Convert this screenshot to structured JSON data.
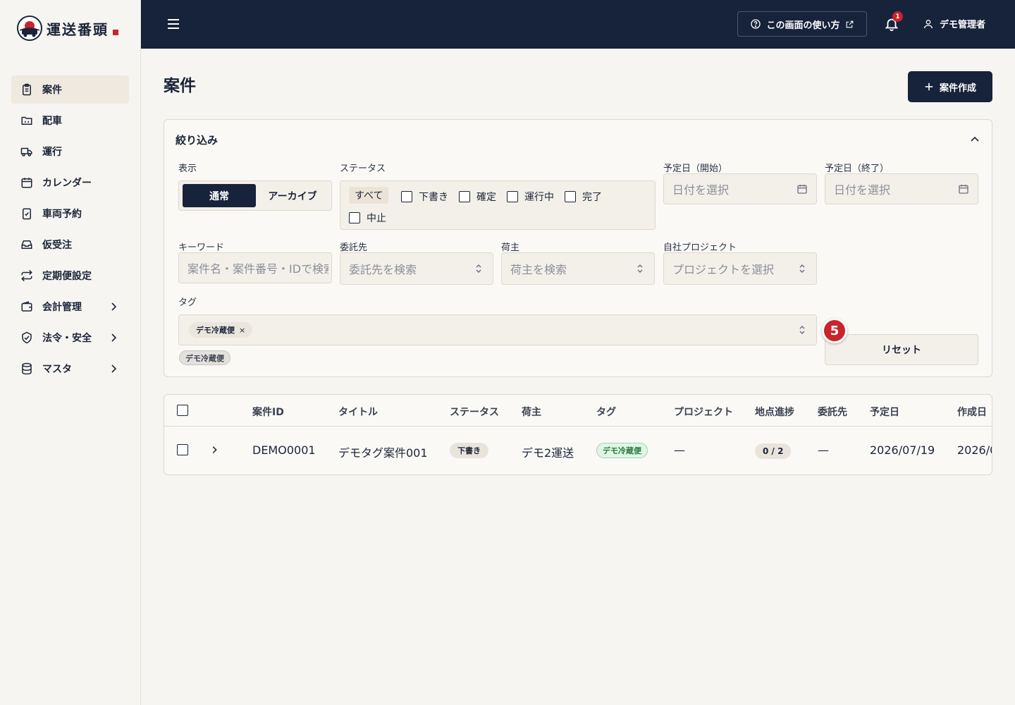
{
  "app": {
    "logo_text": "運送番頭",
    "logo_seal": "運"
  },
  "sidebar": {
    "items": [
      {
        "label": "案件",
        "icon": "clipboard-icon",
        "active": true
      },
      {
        "label": "配車",
        "icon": "folder-icon"
      },
      {
        "label": "運行",
        "icon": "truck-icon"
      },
      {
        "label": "カレンダー",
        "icon": "calendar-icon"
      },
      {
        "label": "車両予約",
        "icon": "clipboard-check-icon"
      },
      {
        "label": "仮受注",
        "icon": "inbox-icon"
      },
      {
        "label": "定期便設定",
        "icon": "repeat-icon"
      },
      {
        "label": "会計管理",
        "icon": "wallet-icon",
        "has_children": true
      },
      {
        "label": "法令・安全",
        "icon": "shield-icon",
        "has_children": true
      },
      {
        "label": "マスタ",
        "icon": "database-icon",
        "has_children": true
      }
    ]
  },
  "header": {
    "help_label": "この画面の使い方",
    "notification_count": "1",
    "user_name": "デモ管理者"
  },
  "page": {
    "title": "案件",
    "create_button": "案件作成"
  },
  "filter": {
    "title": "絞り込み",
    "display_label": "表示",
    "display_options": [
      "通常",
      "アーカイブ"
    ],
    "display_selected": "通常",
    "status_label": "ステータス",
    "status_all": "すべて",
    "status_options": [
      "下書き",
      "確定",
      "運行中",
      "完了",
      "中止"
    ],
    "date_start_label": "予定日（開始）",
    "date_start_placeholder": "日付を選択",
    "date_end_label": "予定日（終了）",
    "date_end_placeholder": "日付を選択",
    "keyword_label": "キーワード",
    "keyword_placeholder": "案件名・案件番号・IDで検索",
    "consignee_label": "委託先",
    "consignee_placeholder": "委託先を検索",
    "shipper_label": "荷主",
    "shipper_placeholder": "荷主を検索",
    "project_label": "自社プロジェクト",
    "project_placeholder": "プロジェクトを選択",
    "tag_label": "タグ",
    "selected_tag": "デモ冷蔵便",
    "tag_remove": "×",
    "available_tag": "デモ冷蔵便",
    "step_marker": "5",
    "reset_label": "リセット"
  },
  "table": {
    "columns": [
      "案件ID",
      "タイトル",
      "ステータス",
      "荷主",
      "タグ",
      "プロジェクト",
      "地点進捗",
      "委託先",
      "予定日",
      "作成日"
    ],
    "rows": [
      {
        "id": "DEMO0001",
        "title": "デモタグ案件001",
        "status": "下書き",
        "shipper": "デモ2運送",
        "tag": "デモ冷蔵便",
        "project": "—",
        "progress": "0 / 2",
        "consignee": "—",
        "scheduled": "2026/07/19",
        "created": "2026/0"
      }
    ]
  }
}
